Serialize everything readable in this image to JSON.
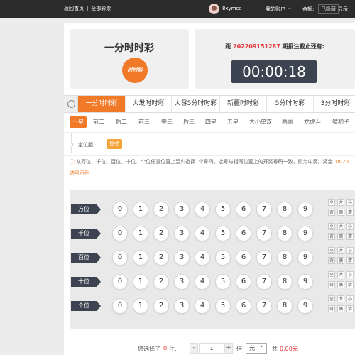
{
  "topbar": {
    "home": "返回首页",
    "separator": "|",
    "all_lottery": "全部彩票",
    "username": "8xymcc",
    "my_account": "我的账户",
    "balance_label": "余额:",
    "balance_value": "已隐藏",
    "show": "显示"
  },
  "game": {
    "title": "一分时时彩",
    "logo_text": "时时彩"
  },
  "draw": {
    "prefix": "距",
    "issue": "202209151287",
    "suffix": "期投注截止还有:",
    "countdown": "00:00:18"
  },
  "game_tabs": [
    {
      "label": "一分时时彩",
      "active": true
    },
    {
      "label": "大发时时彩",
      "active": false
    },
    {
      "label": "大發5分时时彩",
      "active": false
    },
    {
      "label": "新疆时时彩",
      "active": false
    },
    {
      "label": "5分时时彩",
      "active": false
    },
    {
      "label": "3分时时彩",
      "active": false
    }
  ],
  "play_tabs": [
    {
      "label": "一星",
      "active": true
    },
    {
      "label": "前二",
      "active": false
    },
    {
      "label": "后二",
      "active": false
    },
    {
      "label": "前三",
      "active": false
    },
    {
      "label": "中三",
      "active": false
    },
    {
      "label": "后三",
      "active": false
    },
    {
      "label": "四星",
      "active": false
    },
    {
      "label": "五星",
      "active": false
    },
    {
      "label": "大小单双",
      "active": false
    },
    {
      "label": "两面",
      "active": false
    },
    {
      "label": "龙虎斗",
      "active": false
    },
    {
      "label": "猜豹子",
      "active": false
    }
  ],
  "sub_play": {
    "label": "定位胆",
    "button": "复式"
  },
  "hint": {
    "text": "从万位、千位、百位、十位、个位任意位置上至少选择1个号码，选号与相同位置上的开奖号码一致，即为中奖。奖金",
    "prize": "18.20",
    "example": "选号示例"
  },
  "rows": [
    {
      "label": "万位"
    },
    {
      "label": "千位"
    },
    {
      "label": "百位"
    },
    {
      "label": "十位"
    },
    {
      "label": "个位"
    }
  ],
  "numbers": [
    "0",
    "1",
    "2",
    "3",
    "4",
    "5",
    "6",
    "7",
    "8",
    "9"
  ],
  "quick_select": [
    "全",
    "大",
    "小",
    "奇",
    "偶",
    "清"
  ],
  "bottom": {
    "selected_prefix": "您选择了",
    "selected_count": "0",
    "selected_suffix": "注,",
    "minus": "-",
    "multiple": "1",
    "plus": "+",
    "times_label": "倍",
    "unit": "元",
    "total_prefix": "共",
    "total_value": "0.00元"
  },
  "colors": {
    "accent": "#f07a28",
    "dark": "#3b4450",
    "highlight_red": "#e4393c"
  }
}
